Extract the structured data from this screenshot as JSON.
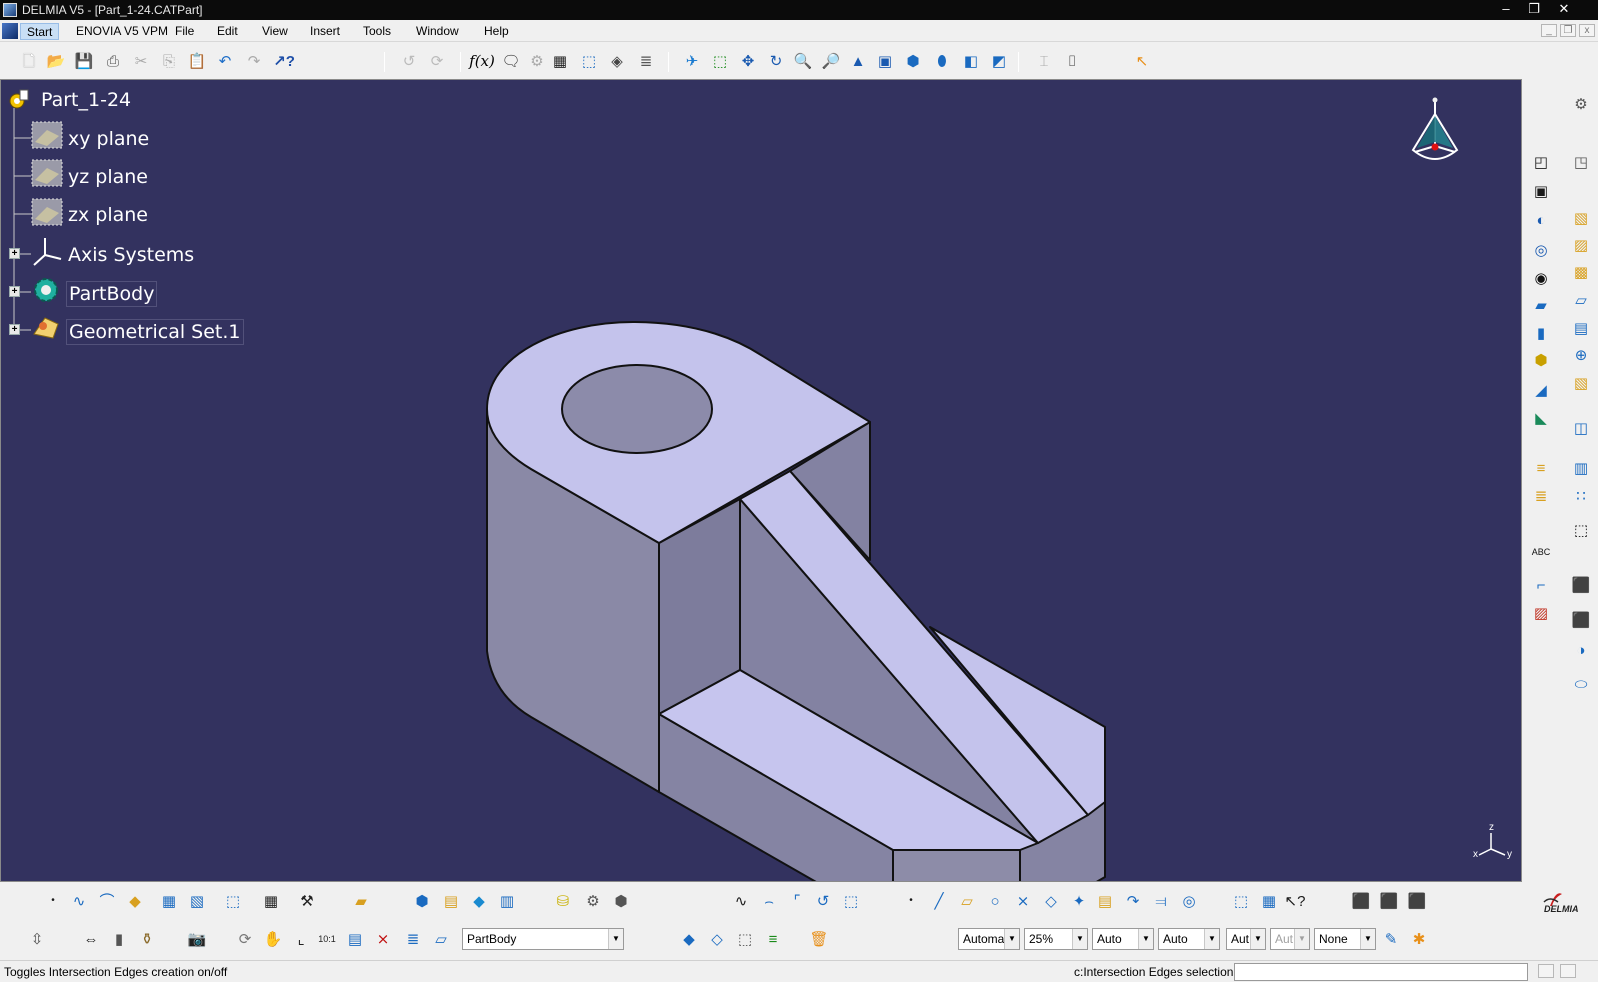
{
  "window": {
    "title": "DELMIA V5 - [Part_1-24.CATPart]",
    "controls": [
      "minimize",
      "restore",
      "close"
    ]
  },
  "menubar": {
    "items": [
      "Start",
      "ENOVIA V5 VPM",
      "File",
      "Edit",
      "View",
      "Insert",
      "Tools",
      "Window",
      "Help"
    ],
    "active_item": "Start"
  },
  "tree": {
    "root": "Part_1-24",
    "nodes": [
      {
        "label": "xy plane",
        "icon": "plane-icon",
        "expandable": false
      },
      {
        "label": "yz plane",
        "icon": "plane-icon",
        "expandable": false
      },
      {
        "label": "zx plane",
        "icon": "plane-icon",
        "expandable": false
      },
      {
        "label": "Axis Systems",
        "icon": "axis-system-icon",
        "expandable": true
      },
      {
        "label": "PartBody",
        "icon": "partbody-gear-icon",
        "expandable": true
      },
      {
        "label": "Geometrical Set.1",
        "icon": "geometrical-set-icon",
        "expandable": true
      }
    ]
  },
  "viewport": {
    "background": "#33325f",
    "part_face_color": "#c4c3ec",
    "part_side_color": "#8b8aa8",
    "compass_label": "Z",
    "axis_labels": {
      "z": "z",
      "x": "x",
      "y": "y"
    }
  },
  "bottom_toolbar": {
    "body_combo": "PartBody",
    "combos": [
      {
        "name": "line-type-combo",
        "value": "Automa",
        "disabled": false
      },
      {
        "name": "transparency-combo",
        "value": "25%",
        "disabled": false
      },
      {
        "name": "line-thickness-combo",
        "value": "Auto",
        "disabled": false
      },
      {
        "name": "point-symbol-combo",
        "value": "Auto",
        "disabled": false
      },
      {
        "name": "render-style-combo",
        "value": "Aut",
        "disabled": false
      },
      {
        "name": "layer-combo-disabled",
        "value": "Aut",
        "disabled": true
      },
      {
        "name": "layer-combo",
        "value": "None",
        "disabled": false
      }
    ],
    "brand": "DELMIA"
  },
  "statusbar": {
    "message": "Toggles Intersection Edges creation on/off",
    "command_label": "c:Intersection Edges selection",
    "command_value": ""
  }
}
